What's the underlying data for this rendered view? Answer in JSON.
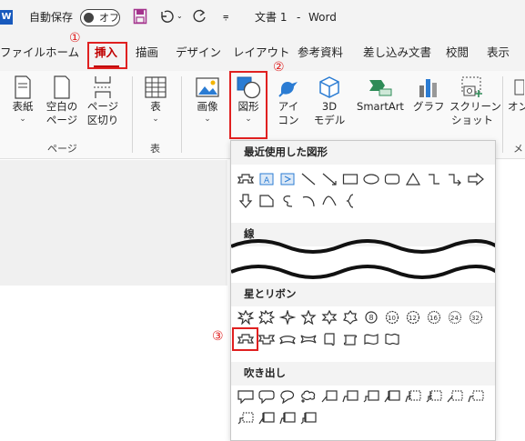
{
  "app": {
    "logo": "W",
    "autosave_label": "自動保存",
    "autosave_state": "オフ",
    "doc_title": "文書 1",
    "separator": "-",
    "app_name": "Word"
  },
  "tabs": [
    "ファイル",
    "ホーム",
    "挿入",
    "描画",
    "デザイン",
    "レイアウト",
    "参考資料",
    "差し込み文書",
    "校閲",
    "表示"
  ],
  "active_tab": "挿入",
  "ribbon": {
    "pages": {
      "cover_l1": "表紙",
      "blank_l1": "空白の",
      "blank_l2": "ページ",
      "break_l1": "ページ",
      "break_l2": "区切り",
      "group": "ページ"
    },
    "table": {
      "label": "表",
      "group": "表"
    },
    "illustrations": {
      "image": "画像",
      "shapes": "図形",
      "icons_l1": "アイ",
      "icons_l2": "コン",
      "model_l1": "3D",
      "model_l2": "モデル",
      "smartart": "SmartArt",
      "graph": "グラフ",
      "screenshot_l1": "スクリーン",
      "screenshot_l2": "ショット"
    },
    "cut_off_l1": "オン",
    "cut_off_group": "メ"
  },
  "gallery": {
    "sections": {
      "recent": "最近使用した図形",
      "lines": "線",
      "stars": "星とリボン",
      "callouts": "吹き出し"
    }
  },
  "annotations": {
    "n1": "①",
    "n2": "②",
    "n3": "③"
  },
  "colors": {
    "accent": "#c00000",
    "highlight": "#e02020",
    "word_blue": "#185abd"
  }
}
